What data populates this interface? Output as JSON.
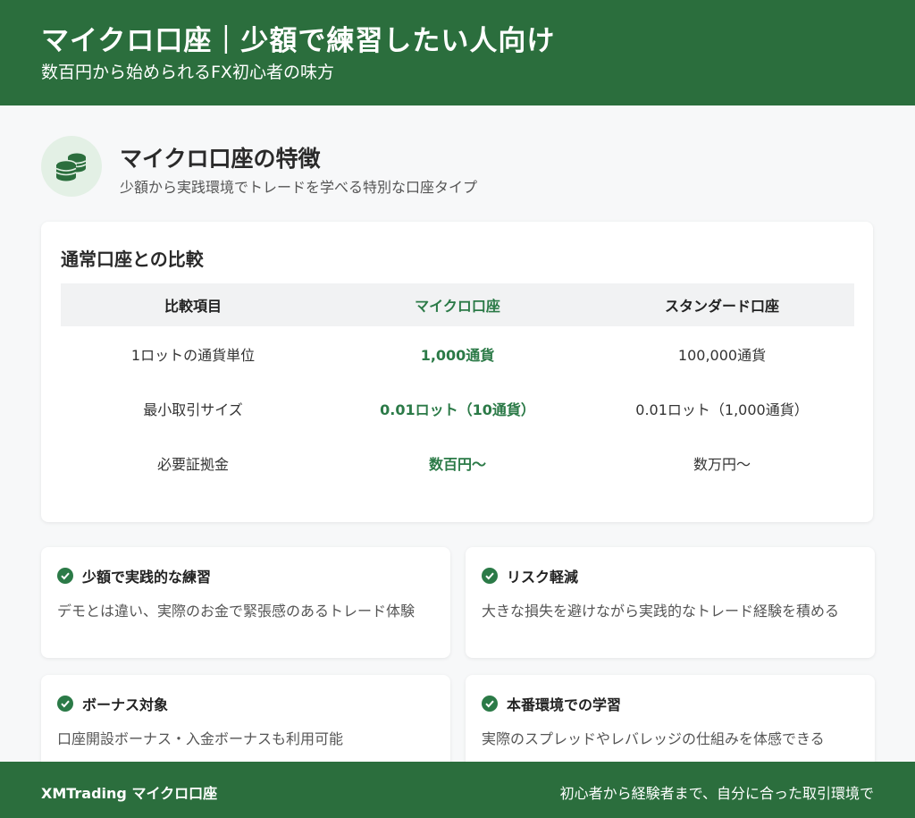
{
  "header": {
    "title": "マイクロ口座｜少額で練習したい人向け",
    "subtitle": "数百円から始められるFX初心者の味方"
  },
  "section": {
    "icon": "coins-icon",
    "title": "マイクロ口座の特徴",
    "subtitle": "少額から実践環境でトレードを学べる特別な口座タイプ"
  },
  "comparison": {
    "title": "通常口座との比較",
    "headers": [
      "比較項目",
      "マイクロ口座",
      "スタンダード口座"
    ],
    "rows": [
      [
        "1ロットの通貨単位",
        "1,000通貨",
        "100,000通貨"
      ],
      [
        "最小取引サイズ",
        "0.01ロット（10通貨）",
        "0.01ロット（1,000通貨）"
      ],
      [
        "必要証拠金",
        "数百円〜",
        "数万円〜"
      ]
    ]
  },
  "features": [
    {
      "title": "少額で実践的な練習",
      "text": "デモとは違い、実際のお金で緊張感のあるトレード体験"
    },
    {
      "title": "リスク軽減",
      "text": "大きな損失を避けながら実践的なトレード経験を積める"
    },
    {
      "title": "ボーナス対象",
      "text": "口座開設ボーナス・入金ボーナスも利用可能"
    },
    {
      "title": "本番環境での学習",
      "text": "実際のスプレッドやレバレッジの仕組みを体感できる"
    }
  ],
  "footer": {
    "left": "XMTrading マイクロ口座",
    "right": "初心者から経験者まで、自分に合った取引環境で"
  },
  "colors": {
    "primary": "#2b6e3d",
    "accent": "#2b7a47",
    "icon_bg": "#e3f0e5"
  }
}
